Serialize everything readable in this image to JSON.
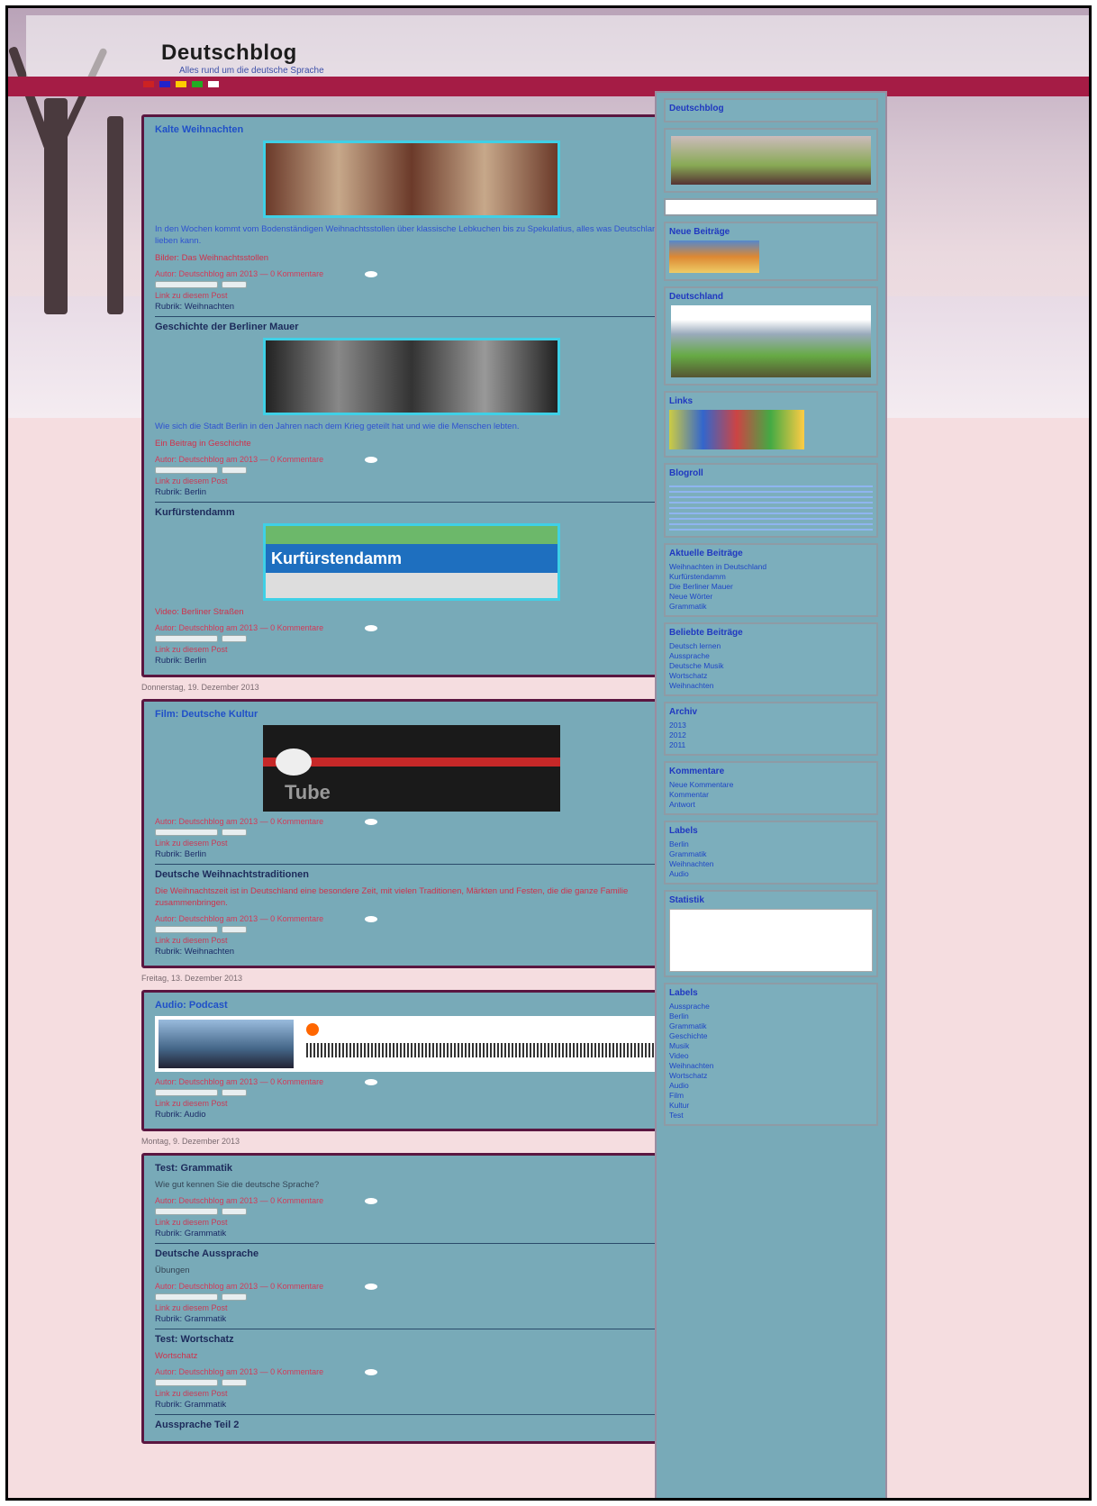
{
  "header": {
    "blog_title": "Deutschblog",
    "subtitle": "Alles rund um die deutsche Sprache"
  },
  "posts": [
    {
      "title": "Kalte Weihnachten",
      "text": "In den Wochen kommt vom Bodenständigen Weihnachtsstollen über klassische Lebkuchen bis zu Spekulatius, alles was Deutschland lieben kann.",
      "link": "Bilder: Das Weihnachtsstollen",
      "author": "Autor: Deutschblog am 2013 — 0 Kommentare",
      "share": "Link zu diesem Post",
      "category": "Rubrik: Weihnachten"
    },
    {
      "title": "Geschichte der Berliner Mauer",
      "text": "Wie sich die Stadt Berlin in den Jahren nach dem Krieg geteilt hat und wie die Menschen lebten.",
      "link": "Ein Beitrag in Geschichte",
      "author": "Autor: Deutschblog am 2013 — 0 Kommentare",
      "share": "Link zu diesem Post",
      "category": "Rubrik: Berlin"
    },
    {
      "title": "Kurfürstendamm",
      "img_label": "Kurfürstendamm",
      "text": "Video: Berliner Straßen",
      "author": "Autor: Deutschblog am 2013 — 0 Kommentare",
      "share": "Link zu diesem Post",
      "category": "Rubrik: Berlin"
    }
  ],
  "dates": [
    "Donnerstag, 19. Dezember 2013",
    "Freitag, 13. Dezember 2013",
    "Montag, 9. Dezember 2013"
  ],
  "video_post": {
    "title": "Film: Deutsche Kultur",
    "img_label": "Tube",
    "author": "Autor: Deutschblog am 2013 — 0 Kommentare",
    "share": "Link zu diesem Post",
    "category": "Rubrik: Berlin",
    "post2_title": "Deutsche Weihnachtstraditionen",
    "post2_text": "Die Weihnachtszeit ist in Deutschland eine besondere Zeit, mit vielen Traditionen, Märkten und Festen, die die ganze Familie zusammenbringen.",
    "post2_author": "Autor: Deutschblog am 2013 — 0 Kommentare",
    "post2_share": "Link zu diesem Post",
    "post2_category": "Rubrik: Weihnachten"
  },
  "audio_post": {
    "title": "Audio: Podcast",
    "author": "Autor: Deutschblog am 2013 — 0 Kommentare",
    "share": "Link zu diesem Post",
    "category": "Rubrik: Audio"
  },
  "misc_post": {
    "p1_title": "Test: Grammatik",
    "p1_text": "Wie gut kennen Sie die deutsche Sprache?",
    "p1_author": "Autor: Deutschblog am 2013 — 0 Kommentare",
    "p1_share": "Link zu diesem Post",
    "p1_category": "Rubrik: Grammatik",
    "p2_title": "Deutsche Aussprache",
    "p2_text": "Übungen",
    "p2_author": "Autor: Deutschblog am 2013 — 0 Kommentare",
    "p2_share": "Link zu diesem Post",
    "p2_category": "Rubrik: Grammatik",
    "p3_title": "Test: Wortschatz",
    "p3_text": "Wortschatz",
    "p3_author": "Autor: Deutschblog am 2013 — 0 Kommentare",
    "p3_share": "Link zu diesem Post",
    "p3_category": "Rubrik: Grammatik",
    "p4_title": "Aussprache Teil 2"
  },
  "sidebar": {
    "w1_title": "Deutschblog",
    "w2_title": "Neue Beiträge",
    "w3_title": "Deutschland",
    "w4_title": "Links",
    "w5_title": "Blogroll",
    "w6_title": "Aktuelle Beiträge",
    "w6_links": [
      "Weihnachten in Deutschland",
      "Kurfürstendamm",
      "Die Berliner Mauer",
      "Neue Wörter",
      "Grammatik"
    ],
    "w7_title": "Beliebte Beiträge",
    "w7_links": [
      "Deutsch lernen",
      "Aussprache",
      "Deutsche Musik",
      "Wortschatz",
      "Weihnachten"
    ],
    "w8_title": "Archiv",
    "w8_links": [
      "2013",
      "2012",
      "2011"
    ],
    "w9_title": "Kommentare",
    "w9_links": [
      "Neue Kommentare",
      "Kommentar",
      "Antwort"
    ],
    "w10_title": "Labels",
    "w10_links": [
      "Berlin",
      "Grammatik",
      "Weihnachten",
      "Audio"
    ],
    "w11_title": "Statistik",
    "w12_title": "Labels",
    "w12_links": [
      "Aussprache",
      "Berlin",
      "Grammatik",
      "Geschichte",
      "Musik",
      "Video",
      "Weihnachten",
      "Wortschatz",
      "Audio",
      "Film",
      "Kultur",
      "Test"
    ]
  }
}
